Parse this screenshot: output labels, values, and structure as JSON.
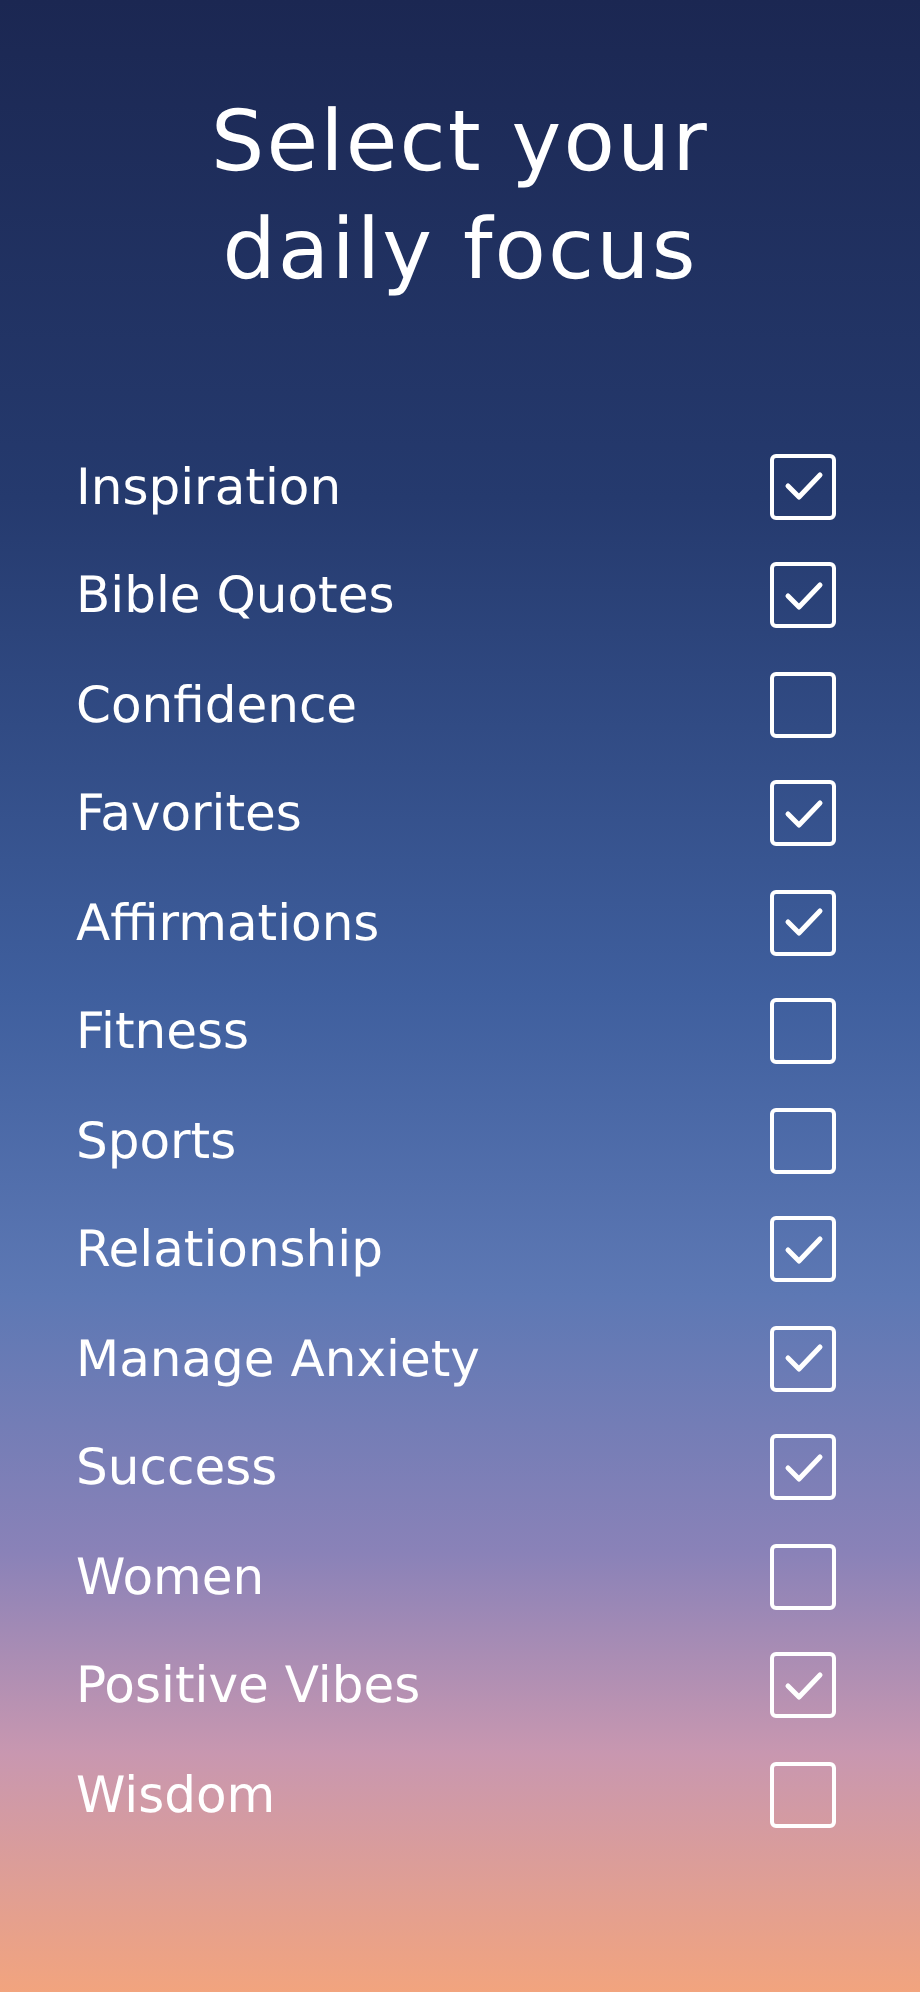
{
  "title": "Select your daily focus",
  "items": [
    {
      "label": "Inspiration",
      "checked": true
    },
    {
      "label": "Bible Quotes",
      "checked": true
    },
    {
      "label": "Confidence",
      "checked": false
    },
    {
      "label": "Favorites",
      "checked": true
    },
    {
      "label": "Affirmations",
      "checked": true
    },
    {
      "label": "Fitness",
      "checked": false
    },
    {
      "label": "Sports",
      "checked": false
    },
    {
      "label": "Relationship",
      "checked": true
    },
    {
      "label": "Manage Anxiety",
      "checked": true
    },
    {
      "label": "Success",
      "checked": true
    },
    {
      "label": "Women",
      "checked": false
    },
    {
      "label": "Positive Vibes",
      "checked": true
    },
    {
      "label": "Wisdom",
      "checked": false
    }
  ]
}
